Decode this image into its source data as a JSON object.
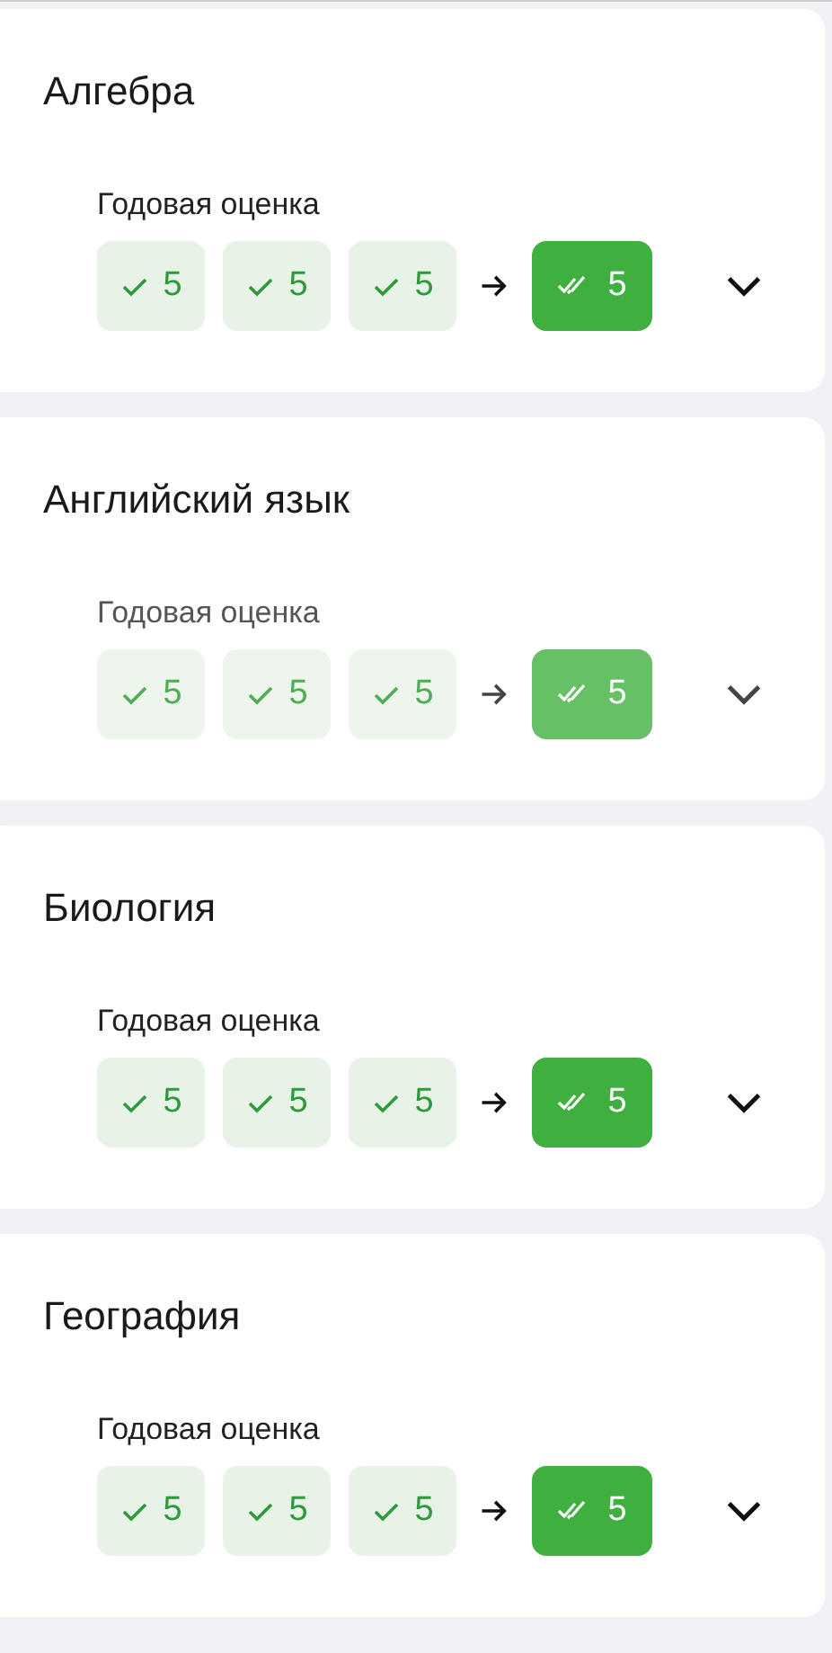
{
  "subjects": [
    {
      "name": "Алгебра",
      "dimmed": false,
      "label": "Годовая оценка",
      "marks": [
        "5",
        "5",
        "5"
      ],
      "final": "5",
      "expanded": false
    },
    {
      "name": "Английский язык",
      "dimmed": true,
      "label": "Годовая оценка",
      "marks": [
        "5",
        "5",
        "5"
      ],
      "final": "5",
      "expanded": false
    },
    {
      "name": "Биология",
      "dimmed": false,
      "label": "Годовая оценка",
      "marks": [
        "5",
        "5",
        "5"
      ],
      "final": "5",
      "expanded": false
    },
    {
      "name": "География",
      "dimmed": false,
      "label": "Годовая оценка",
      "marks": [
        "5",
        "5",
        "5"
      ],
      "final": "5",
      "expanded": false
    }
  ]
}
